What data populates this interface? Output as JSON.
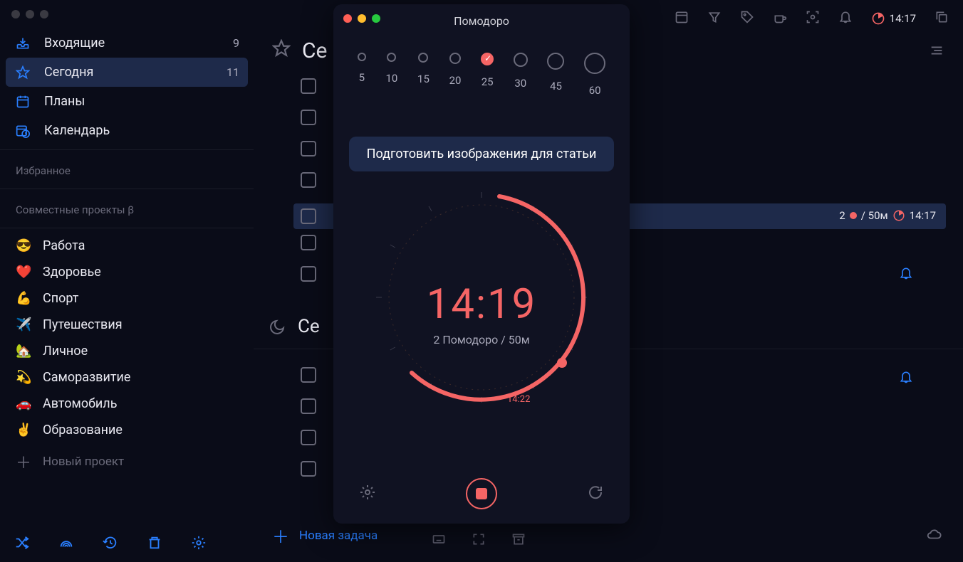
{
  "sidebar": {
    "inbox_label": "Входящие",
    "inbox_count": "9",
    "today_label": "Сегодня",
    "today_count": "11",
    "plans_label": "Планы",
    "calendar_label": "Календарь",
    "favorites_header": "Избранное",
    "shared_header": "Совместные проекты β",
    "new_project": "Новый проект"
  },
  "projects": {
    "p0": {
      "emoji": "😎",
      "label": "Работа"
    },
    "p1": {
      "emoji": "❤️",
      "label": "Здоровье"
    },
    "p2": {
      "emoji": "💪",
      "label": "Спорт"
    },
    "p3": {
      "emoji": "✈️",
      "label": "Путешествия"
    },
    "p4": {
      "emoji": "🏡",
      "label": "Личное"
    },
    "p5": {
      "emoji": "💫",
      "label": "Саморазвитие"
    },
    "p6": {
      "emoji": "🚗",
      "label": "Автомобиль"
    },
    "p7": {
      "emoji": "✌️",
      "label": "Образование"
    }
  },
  "main": {
    "title_partial_1": "Се",
    "title_partial_2": "Се",
    "bottom_new_task": "Новая задача",
    "selected_task_meta": {
      "count": "2",
      "total": "/ 50м",
      "time": "14:17"
    }
  },
  "toolbar": {
    "clock": "14:17"
  },
  "pomodoro": {
    "title": "Помодоро",
    "durations": {
      "d5": "5",
      "d10": "10",
      "d15": "15",
      "d20": "20",
      "d25": "25",
      "d30": "30",
      "d45": "45",
      "d60": "60"
    },
    "task_name": "Подготовить изображения для статьи",
    "timer": "14:19",
    "subtitle": "2 Помодоро / 50м",
    "end_time": "14:22"
  }
}
